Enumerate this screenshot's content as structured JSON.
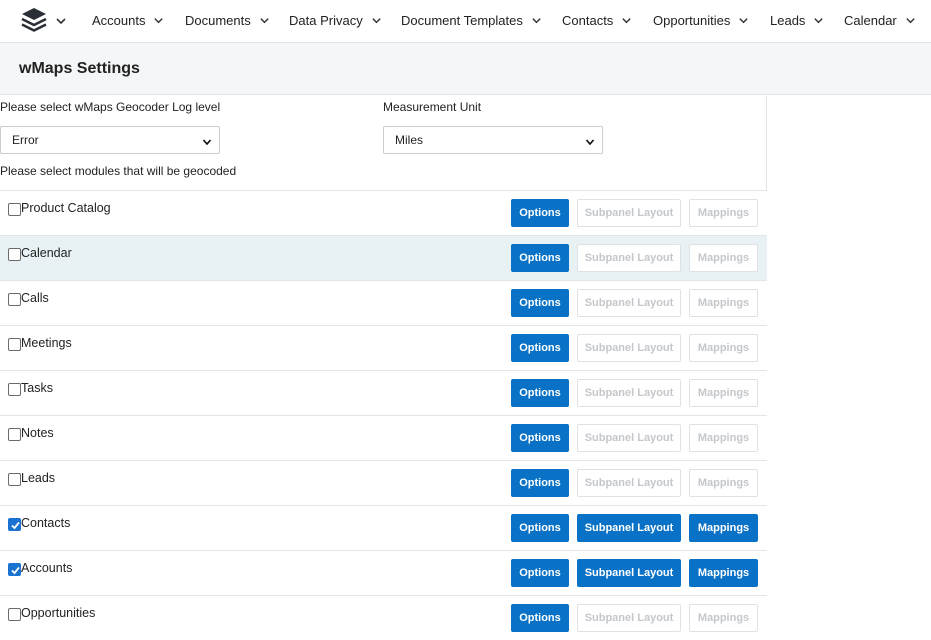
{
  "nav": {
    "items": [
      {
        "label": "Accounts"
      },
      {
        "label": "Documents"
      },
      {
        "label": "Data Privacy"
      },
      {
        "label": "Document Templates"
      },
      {
        "label": "Contacts"
      },
      {
        "label": "Opportunities"
      },
      {
        "label": "Leads"
      },
      {
        "label": "Calendar"
      }
    ]
  },
  "header": {
    "title": "wMaps Settings"
  },
  "settings": {
    "log_level_label": "Please select wMaps Geocoder Log level",
    "log_level_value": "Error",
    "unit_label": "Measurement Unit",
    "unit_value": "Miles",
    "modules_label": "Please select modules that will be geocoded"
  },
  "buttons": {
    "options": "Options",
    "subpanel": "Subpanel Layout",
    "mappings": "Mappings"
  },
  "modules": [
    {
      "name": "Product Catalog",
      "checked": false
    },
    {
      "name": "Calendar",
      "checked": false
    },
    {
      "name": "Calls",
      "checked": false
    },
    {
      "name": "Meetings",
      "checked": false
    },
    {
      "name": "Tasks",
      "checked": false
    },
    {
      "name": "Notes",
      "checked": false
    },
    {
      "name": "Leads",
      "checked": false
    },
    {
      "name": "Contacts",
      "checked": true
    },
    {
      "name": "Accounts",
      "checked": true
    },
    {
      "name": "Opportunities",
      "checked": false
    }
  ],
  "colors": {
    "accent": "#0a72c6",
    "row_highlight": "#e8f1f4"
  }
}
